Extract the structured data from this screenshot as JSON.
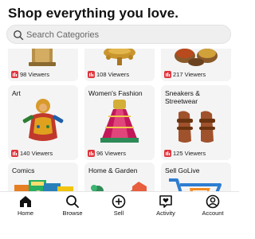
{
  "header": {
    "title": "Shop everything you love.",
    "search_placeholder": "Search Categories"
  },
  "categories": [
    {
      "label": "",
      "viewers": "98 Viewers"
    },
    {
      "label": "",
      "viewers": "108 Viewers"
    },
    {
      "label": "",
      "viewers": "217 Viewers"
    },
    {
      "label": "Art",
      "viewers": "140 Viewers"
    },
    {
      "label": "Women's Fashion",
      "viewers": "96 Viewers"
    },
    {
      "label": "Sneakers & Streetwear",
      "viewers": "125 Viewers"
    },
    {
      "label": "Comics",
      "viewers": ""
    },
    {
      "label": "Home & Garden",
      "viewers": ""
    },
    {
      "label": "Sell GoLive",
      "viewers": ""
    }
  ],
  "tabbar": {
    "tabs": [
      {
        "label": "Home",
        "icon": "home-icon",
        "active": true
      },
      {
        "label": "Browse",
        "icon": "search-icon"
      },
      {
        "label": "Sell",
        "icon": "plus-circle-icon"
      },
      {
        "label": "Activity",
        "icon": "heart-chat-icon"
      },
      {
        "label": "Account",
        "icon": "user-circle-icon"
      }
    ]
  },
  "colors": {
    "viewer_icon": "#e0353d",
    "card_bg": "#f4f4f4",
    "sell_accent": "#f28a23"
  }
}
